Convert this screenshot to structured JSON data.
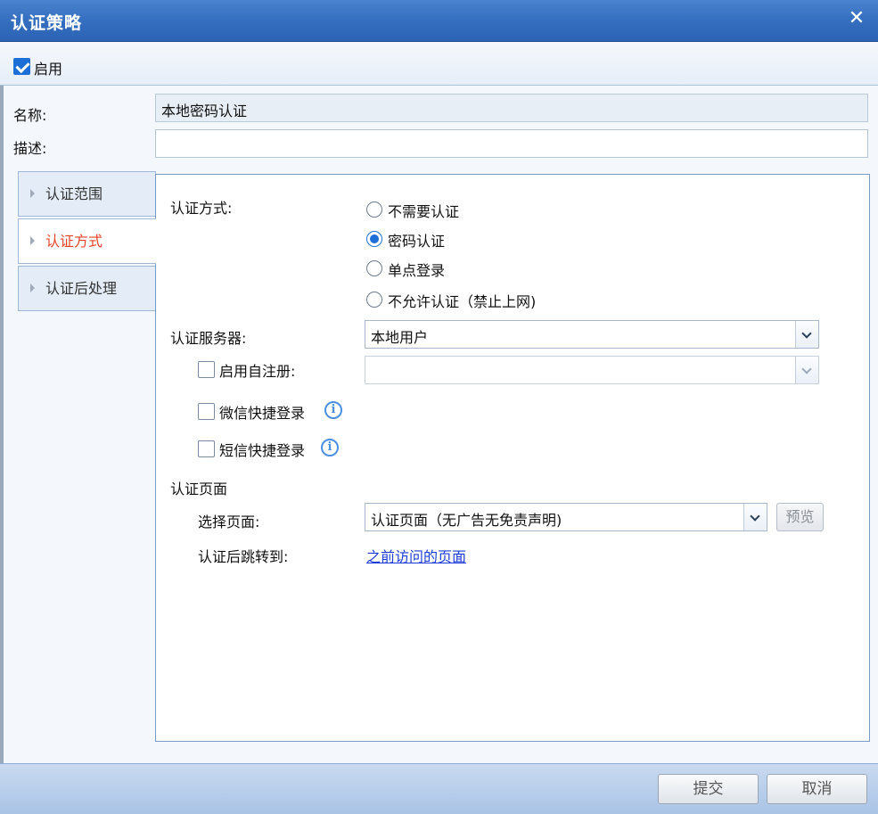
{
  "dialog": {
    "title": "认证策略",
    "close_glyph": "✕"
  },
  "enable": {
    "label": "启用",
    "checked": true
  },
  "form": {
    "name_label": "名称:",
    "name_value": "本地密码认证",
    "desc_label": "描述:",
    "desc_value": ""
  },
  "nav": {
    "items": [
      {
        "label": "认证范围",
        "active": false
      },
      {
        "label": "认证方式",
        "active": true
      },
      {
        "label": "认证后处理",
        "active": false
      }
    ]
  },
  "auth": {
    "method_label": "认证方式:",
    "options": [
      {
        "label": "不需要认证",
        "selected": false
      },
      {
        "label": "密码认证",
        "selected": true
      },
      {
        "label": "单点登录",
        "selected": false
      },
      {
        "label": "不允许认证（禁止上网)",
        "selected": false
      }
    ],
    "server_label": "认证服务器:",
    "server_value": "本地用户",
    "self_register_label": "启用自注册:",
    "self_register_value": "",
    "wechat_label": "微信快捷登录",
    "sms_label": "短信快捷登录",
    "info_glyph": "i"
  },
  "page": {
    "section_label": "认证页面",
    "select_label": "选择页面:",
    "select_value": "认证页面（无广告无免责声明)",
    "preview_label": "预览",
    "redirect_label": "认证后跳转到:",
    "redirect_link": "之前访问的页面"
  },
  "footer": {
    "submit_label": "提交",
    "cancel_label": "取消"
  },
  "colors": {
    "accent": "#1d6fd8",
    "active_nav": "#e8442b",
    "link": "#1a3bd8",
    "titlebar": "#3670c0"
  }
}
